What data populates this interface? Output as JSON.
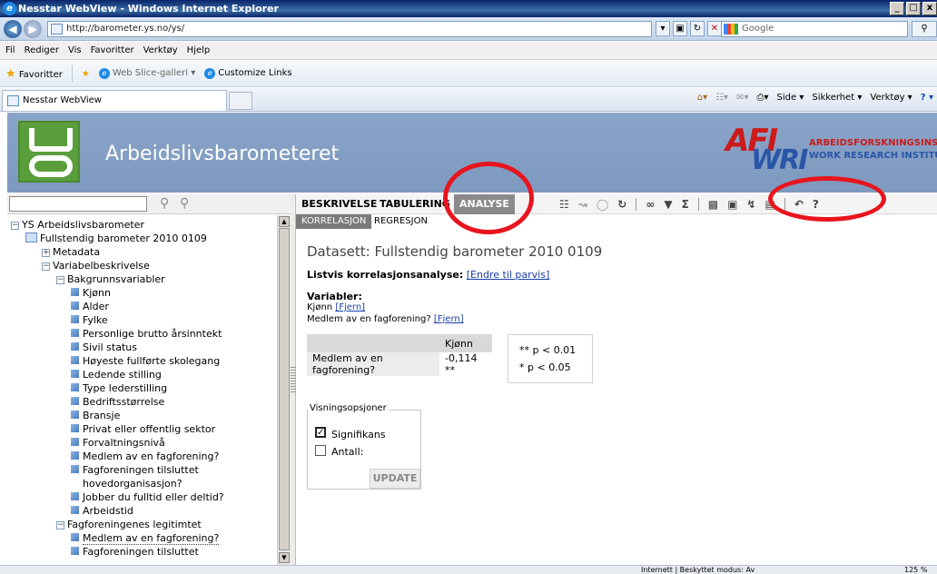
{
  "window": {
    "title": "Nesstar WebView - Windows Internet Explorer",
    "minimize": "_",
    "maximize": "□",
    "close": "x"
  },
  "address": {
    "url": "http://barometer.ys.no/ys/",
    "search_placeholder": "Google"
  },
  "menu": {
    "items": [
      "Fil",
      "Rediger",
      "Vis",
      "Favoritter",
      "Verktøy",
      "Hjelp"
    ]
  },
  "favorites": {
    "label": "Favoritter",
    "slice": "Web Slice-galleri ▾",
    "custom": "Customize Links"
  },
  "tab": {
    "label": "Nesstar WebView"
  },
  "commandbar": {
    "side": "Side ▾",
    "sikkerhet": "Sikkerhet ▾",
    "verktoy": "Verktøy ▾",
    "help": "? ▾"
  },
  "banner": {
    "title": "Arbeidslivsbarometeret",
    "logo_left": "YS",
    "logo_right_top": "AFI",
    "logo_right_bottom": "WRI",
    "institute_no": "ARBEIDSFORSKNINGSINSTITUTTET",
    "institute_en": "WORK RESEARCH INSTITUTE"
  },
  "tree": {
    "items": [
      "YS Arbeidslivsbarometer",
      "Fullstendig barometer 2010 0109",
      "Metadata",
      "Variabelbeskrivelse",
      "Bakgrunnsvariabler",
      "Kjønn",
      "Alder",
      "Fylke",
      "Personlige brutto årsinntekt",
      "Sivil status",
      "Høyeste fullførte skolegang",
      "Ledende stilling",
      "Type lederstilling",
      "Bedriftsstørrelse",
      "Bransje",
      "Privat eller offentlig sektor",
      "Forvaltningsnivå",
      "Medlem av en fagforening?",
      "Fagforeningen tilsluttet",
      "hovedorganisasjon?",
      "Jobber du fulltid eller deltid?",
      "Arbeidstid",
      "Fagforeningenes legitimtet",
      "Medlem av en fagforening?",
      "Fagforeningen tilsluttet"
    ]
  },
  "maintabs": {
    "beskrivelse": "BESKRIVELSE",
    "tabulering": "TABULERING",
    "analyse": "ANALYSE",
    "help": "?"
  },
  "subtabs": {
    "korrelasjon": "KORRELASJON",
    "regresjon": "REGRESJON"
  },
  "content": {
    "dataset_title": "Datasett: Fullstendig barometer 2010 0109",
    "analysis_label": "Listvis korrelasjonsanalyse:",
    "analysis_link": "[Endre til parvis]",
    "variables_heading": "Variabler:",
    "var1": "Kjønn",
    "var2": "Medlem av en fagforening?",
    "remove_link": "[Fjern]",
    "table": {
      "col_header": "Kjønn",
      "row_label": "Medlem av en fagforening?",
      "value": "-0,114 **"
    },
    "legend": {
      "l1": "** p < 0.01",
      "l2": "*   p < 0.05"
    },
    "options": {
      "legend": "Visningsopsjoner",
      "signifikans": "Signifikans",
      "antall": "Antall:",
      "update": "UPDATE"
    }
  },
  "status": {
    "zone": "Internett | Beskyttet modus: Av",
    "zoom": "125 %"
  },
  "colors": {
    "annotation_red": "#e8141e",
    "banner_blue": "#8aa4c8",
    "tab_active": "#8a8a8a"
  }
}
